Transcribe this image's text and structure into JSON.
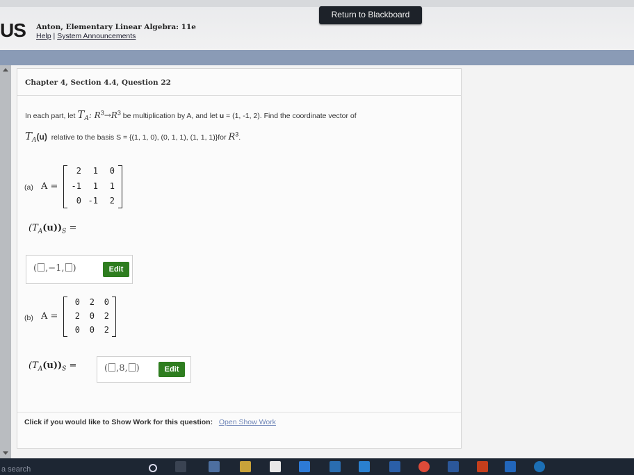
{
  "header": {
    "return_button": "Return to Blackboard",
    "brand": "US",
    "book_title": "Anton, Elementary Linear Algebra: 11e",
    "help_link": "Help",
    "separator": "|",
    "announcements_link": "System Announcements"
  },
  "question": {
    "title": "Chapter 4, Section 4.4, Question 22",
    "intro_a": "In each part, let",
    "intro_map": "T",
    "intro_map_sub": "A",
    "intro_domain": ": R",
    "intro_domain_sup": "3",
    "intro_arrow": "→R",
    "intro_codomain_sup": "3",
    "intro_b": "be multiplication by A, and let",
    "vector_name": "u",
    "intro_c": "= (1, -1, 2). Find the coordinate vector of",
    "line2_T": "T",
    "line2_sub": "A",
    "line2_u": "(u)",
    "line2_text": "relative to the basis S = {(1, 1, 0), (0, 1, 1), (1, 1, 1)}for",
    "line2_R": "R",
    "line2_sup": "3",
    "line2_end": "."
  },
  "part_a": {
    "label": "(a)",
    "matrix_label": "A =",
    "matrix": [
      "2",
      "1",
      "0",
      "-1",
      "1",
      "1",
      "0",
      "-1",
      "2"
    ],
    "result_label": "(T",
    "result_sub": "A",
    "result_rest": "(u))",
    "result_sub2": "S",
    "result_eq": "=",
    "answer_open": "(",
    "answer_sep1": ",",
    "answer_middle": "−1",
    "answer_sep2": ",",
    "answer_close": ")",
    "edit_label": "Edit"
  },
  "part_b": {
    "label": "(b)",
    "matrix_label": "A =",
    "matrix": [
      "0",
      "2",
      "0",
      "2",
      "0",
      "2",
      "0",
      "0",
      "2"
    ],
    "result_label": "(T",
    "result_sub": "A",
    "result_rest": "(u))",
    "result_sub2": "S",
    "result_eq": "=",
    "answer_open": "(",
    "answer_sep1": ",",
    "answer_middle": "8",
    "answer_sep2": ",",
    "answer_close": ")",
    "edit_label": "Edit"
  },
  "footer": {
    "show_work_prompt": "Click if you would like to Show Work for this question:",
    "show_work_link": "Open Show Work"
  },
  "taskbar": {
    "search_text": "a search"
  },
  "colors": {
    "band": "#8a9bb6",
    "edit_button": "#2e7d1f",
    "link": "#6f86b8",
    "taskbar": "#1d2633"
  }
}
